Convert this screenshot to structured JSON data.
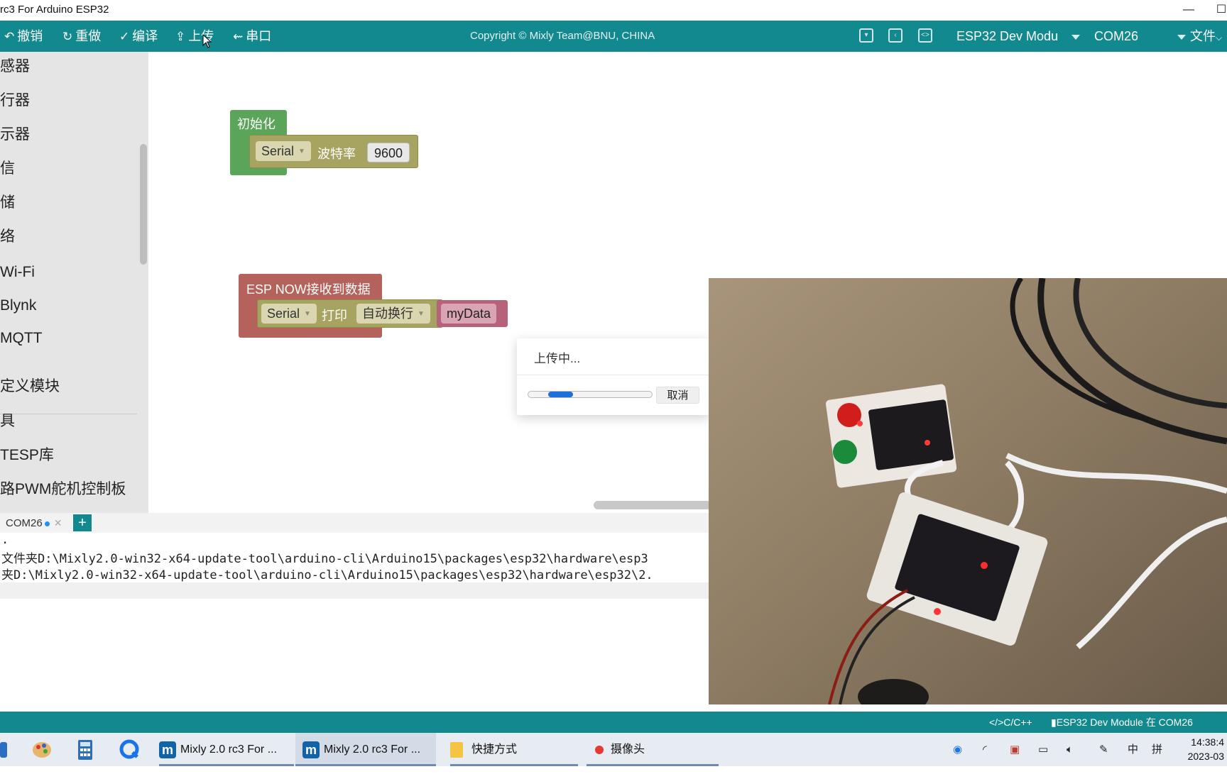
{
  "window": {
    "title": "rc3 For Arduino ESP32",
    "minimize": "—",
    "maximize": "☐"
  },
  "toolbar": {
    "undo": "撤销",
    "redo": "重做",
    "compile": "编译",
    "upload": "上传",
    "serial": "串口",
    "copyright": "Copyright © Mixly Team@BNU, CHINA",
    "board": "ESP32 Dev Modu",
    "port": "COM26",
    "file_menu": "文件"
  },
  "sidebar": {
    "categories": [
      "感器",
      "行器",
      "示器",
      "信",
      "储",
      "络",
      "Wi-Fi",
      "Blynk",
      "MQTT",
      "定义模块",
      "具",
      "TESP库",
      "路PWM舵机控制板"
    ]
  },
  "workspace": {
    "block_init": {
      "header": "初始化",
      "serial": "Serial",
      "baud_label": "波特率",
      "baud": "9600"
    },
    "block_espnow": {
      "header": "ESP NOW接收到数据",
      "serial": "Serial",
      "print_label": "打印",
      "print_mode": "自动换行",
      "var": "myData"
    }
  },
  "upload_dialog": {
    "title": "上传中...",
    "progress": 0.2,
    "cancel": "取消"
  },
  "serial_panel": {
    "tab_name": "COM26",
    "add_tab": "+",
    "lines": [
      ".",
      "文件夹D:\\Mixly2.0-win32-x64-update-tool\\arduino-cli\\Arduino15\\packages\\esp32\\hardware\\esp3",
      "夹D:\\Mixly2.0-win32-x64-update-tool\\arduino-cli\\Arduino15\\packages\\esp32\\hardware\\esp32\\2."
    ]
  },
  "statusbar": {
    "language": "C/C++",
    "board_status": "ESP32 Dev Module 在 COM26"
  },
  "taskbar": {
    "apps": [
      {
        "label": "Mixly 2.0 rc3 For ...",
        "active": false
      },
      {
        "label": "Mixly 2.0 rc3 For ...",
        "active": true
      },
      {
        "label": "快捷方式",
        "active": false
      },
      {
        "label": "摄像头",
        "active": false
      }
    ],
    "ime_lang": "中",
    "ime_mode": "拼",
    "time": "14:38:4",
    "date": "2023-03"
  },
  "colors": {
    "accent": "#11898f",
    "block_green": "#5ba55b",
    "block_red": "#b5625c",
    "block_olive": "#a7a360",
    "progress_blue": "#1e6fd9"
  }
}
